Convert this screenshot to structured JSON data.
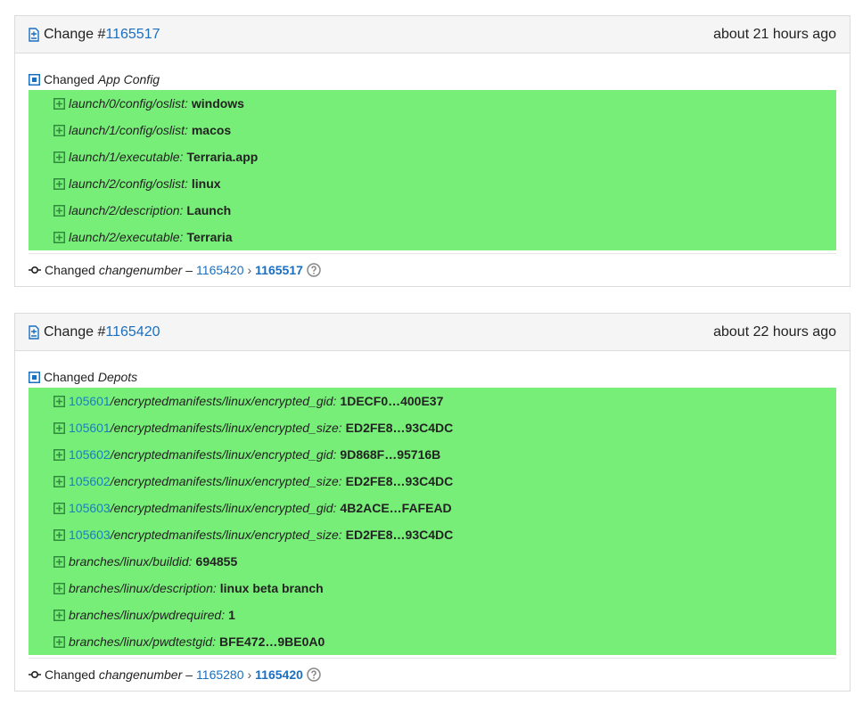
{
  "changes": [
    {
      "prefix": "Change #",
      "number": "1165517",
      "time": "about 21 hours ago",
      "section_prefix": "Changed",
      "section_name": "App Config",
      "rows": [
        {
          "id": "",
          "key": "launch/0/config/oslist:",
          "value": "windows"
        },
        {
          "id": "",
          "key": "launch/1/config/oslist:",
          "value": "macos"
        },
        {
          "id": "",
          "key": "launch/1/executable:",
          "value": "Terraria.app"
        },
        {
          "id": "",
          "key": "launch/2/config/oslist:",
          "value": "linux"
        },
        {
          "id": "",
          "key": "launch/2/description:",
          "value": "Launch"
        },
        {
          "id": "",
          "key": "launch/2/executable:",
          "value": "Terraria"
        }
      ],
      "footer": {
        "prefix": "Changed",
        "field": "changenumber",
        "dash": "–",
        "from": "1165420",
        "arrow": "›",
        "to": "1165517"
      }
    },
    {
      "prefix": "Change #",
      "number": "1165420",
      "time": "about 22 hours ago",
      "section_prefix": "Changed",
      "section_name": "Depots",
      "rows": [
        {
          "id": "105601",
          "key": "/encryptedmanifests/linux/encrypted_gid:",
          "value": "1DECF0…400E37"
        },
        {
          "id": "105601",
          "key": "/encryptedmanifests/linux/encrypted_size:",
          "value": "ED2FE8…93C4DC"
        },
        {
          "id": "105602",
          "key": "/encryptedmanifests/linux/encrypted_gid:",
          "value": "9D868F…95716B"
        },
        {
          "id": "105602",
          "key": "/encryptedmanifests/linux/encrypted_size:",
          "value": "ED2FE8…93C4DC"
        },
        {
          "id": "105603",
          "key": "/encryptedmanifests/linux/encrypted_gid:",
          "value": "4B2ACE…FAFEAD"
        },
        {
          "id": "105603",
          "key": "/encryptedmanifests/linux/encrypted_size:",
          "value": "ED2FE8…93C4DC"
        },
        {
          "id": "",
          "key": "branches/linux/buildid:",
          "value": "694855"
        },
        {
          "id": "",
          "key": "branches/linux/description:",
          "value": "linux beta branch"
        },
        {
          "id": "",
          "key": "branches/linux/pwdrequired:",
          "value": "1"
        },
        {
          "id": "",
          "key": "branches/linux/pwdtestgid:",
          "value": "BFE472…9BE0A0"
        }
      ],
      "footer": {
        "prefix": "Changed",
        "field": "changenumber",
        "dash": "–",
        "from": "1165280",
        "arrow": "›",
        "to": "1165420"
      }
    }
  ],
  "colors": {
    "added_row_bg": "#77ee77",
    "link": "#1a6fbf",
    "header_bg": "#f5f5f5"
  }
}
